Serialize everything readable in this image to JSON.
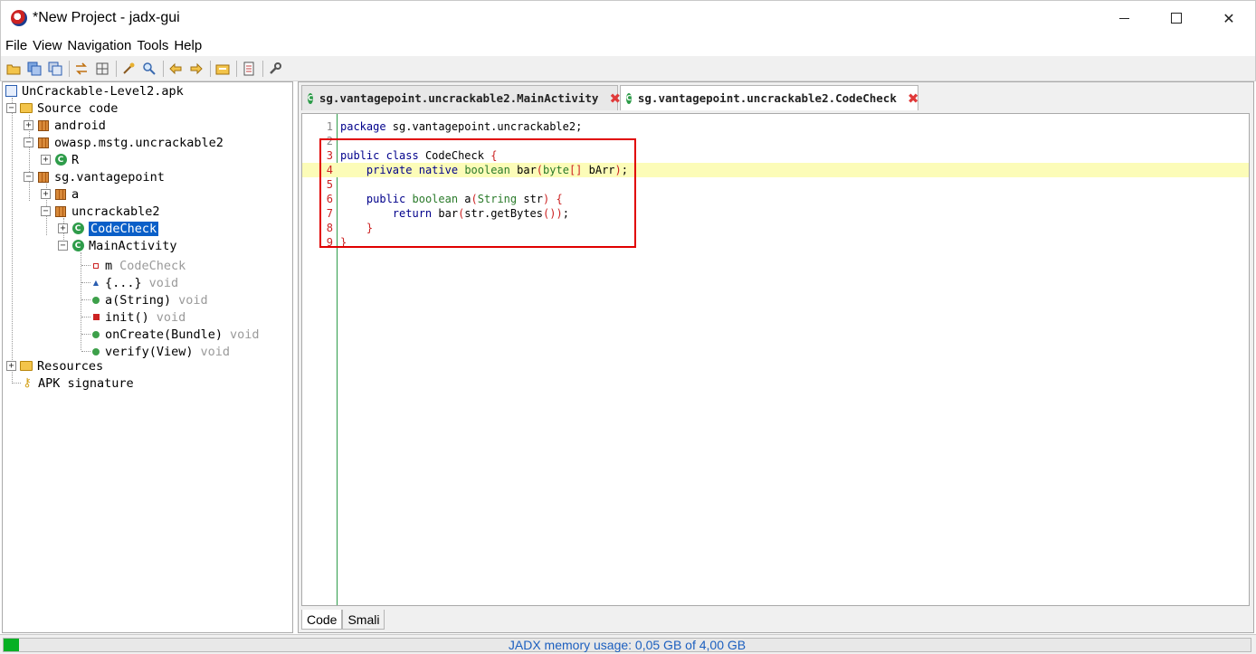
{
  "window": {
    "title": "*New Project - jadx-gui",
    "controls": {
      "minimize": "minimize",
      "maximize": "maximize",
      "close": "✕"
    }
  },
  "menu": [
    "File",
    "View",
    "Navigation",
    "Tools",
    "Help"
  ],
  "toolbar": {
    "icons": [
      "open-file-icon",
      "save-all-icon",
      "export-icon",
      "sync-icon",
      "flatten-packages-icon",
      "decompile-all-icon",
      "search-icon",
      "back-icon",
      "forward-icon",
      "deobfuscation-icon",
      "log-icon",
      "preferences-icon"
    ]
  },
  "tree": {
    "root": "UnCrackable-Level2.apk",
    "source_code": "Source code",
    "packages": {
      "android": "android",
      "owasp": "owasp.mstg.uncrackable2",
      "owasp_R": "R",
      "sg": "sg.vantagepoint",
      "sg_a": "a",
      "uncrackable2": "uncrackable2",
      "codecheck": "CodeCheck",
      "mainactivity": "MainActivity"
    },
    "members": [
      {
        "name": "m",
        "type": "CodeCheck"
      },
      {
        "name": "{...}",
        "type": "void"
      },
      {
        "name": "a(String)",
        "type": "void"
      },
      {
        "name": "init()",
        "type": "void"
      },
      {
        "name": "onCreate(Bundle)",
        "type": "void"
      },
      {
        "name": "verify(View)",
        "type": "void"
      }
    ],
    "resources": "Resources",
    "apk_signature": "APK signature"
  },
  "tabs": [
    {
      "label": "sg.vantagepoint.uncrackable2.MainActivity",
      "close": "✖"
    },
    {
      "label": "sg.vantagepoint.uncrackable2.CodeCheck",
      "close": "✖"
    }
  ],
  "code": {
    "line_numbers": [
      "1",
      "2",
      "3",
      "4",
      "5",
      "6",
      "7",
      "8",
      "9"
    ],
    "highlighted_line": 4,
    "lines": [
      "package sg.vantagepoint.uncrackable2;",
      "",
      "public class CodeCheck {",
      "    private native boolean bar(byte[] bArr);",
      "",
      "    public boolean a(String str) {",
      "        return bar(str.getBytes());",
      "    }",
      "}"
    ]
  },
  "bottom_tabs": [
    "Code",
    "Smali"
  ],
  "status": {
    "memory_text": "JADX memory usage: 0,05 GB of 4,00 GB",
    "memory_fraction": 0.0125,
    "accent": "#06b025"
  }
}
